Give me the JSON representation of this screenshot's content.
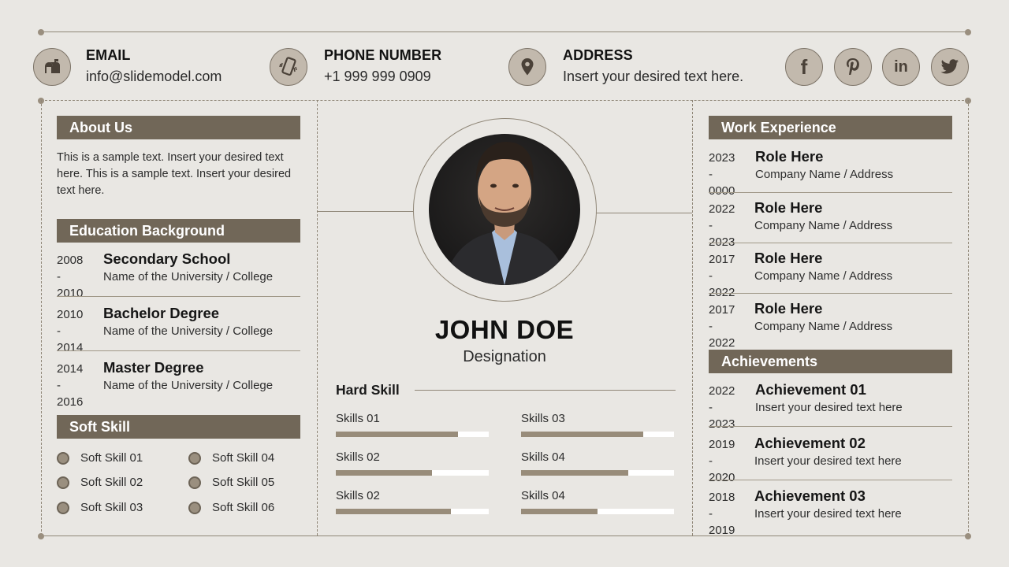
{
  "contact": {
    "email": {
      "label": "EMAIL",
      "value": "info@slidemodel.com",
      "icon": "mailbox-icon"
    },
    "phone": {
      "label": "PHONE NUMBER",
      "value": "+1 999 999 0909",
      "icon": "phone-icon"
    },
    "address": {
      "label": "ADDRESS",
      "value": "Insert your desired text here.",
      "icon": "map-pin-icon"
    }
  },
  "social": [
    {
      "name": "facebook",
      "glyph": "f",
      "icon": "facebook-icon"
    },
    {
      "name": "pinterest",
      "glyph": "P",
      "icon": "pinterest-icon"
    },
    {
      "name": "linkedin",
      "glyph": "in",
      "icon": "linkedin-icon"
    },
    {
      "name": "twitter",
      "glyph": "t",
      "icon": "twitter-icon"
    }
  ],
  "about": {
    "title": "About Us",
    "text": "This is a sample text. Insert your desired text here. This is a sample text. Insert your desired text here."
  },
  "education": {
    "title": "Education Background",
    "items": [
      {
        "years_from": "2008 -",
        "years_to": "2010",
        "degree": "Secondary School",
        "school": "Name of the University / College"
      },
      {
        "years_from": "2010 -",
        "years_to": "2014",
        "degree": "Bachelor Degree",
        "school": "Name of the University / College"
      },
      {
        "years_from": "2014 -",
        "years_to": "2016",
        "degree": "Master Degree",
        "school": "Name of the University / College"
      }
    ]
  },
  "soft_skill": {
    "title": "Soft Skill",
    "items": [
      "Soft Skill 01",
      "Soft Skill 02",
      "Soft Skill 03",
      "Soft Skill 04",
      "Soft Skill 05",
      "Soft Skill 06"
    ]
  },
  "profile": {
    "name": "JOHN DOE",
    "designation": "Designation"
  },
  "hard_skill": {
    "title": "Hard Skill",
    "items": [
      {
        "label": "Skills 01",
        "level": 0.8
      },
      {
        "label": "Skills 02",
        "level": 0.63
      },
      {
        "label": "Skills 02",
        "level": 0.75
      },
      {
        "label": "Skills 03",
        "level": 0.8
      },
      {
        "label": "Skills 04",
        "level": 0.7
      },
      {
        "label": "Skills 04",
        "level": 0.5
      }
    ]
  },
  "work": {
    "title": "Work Experience",
    "items": [
      {
        "years_from": "2023 -",
        "years_to": "0000",
        "role": "Role Here",
        "company": "Company Name / Address"
      },
      {
        "years_from": "2022 -",
        "years_to": "2023",
        "role": "Role Here",
        "company": "Company Name / Address"
      },
      {
        "years_from": "2017 -",
        "years_to": "2022",
        "role": "Role Here",
        "company": "Company Name / Address"
      },
      {
        "years_from": "2017 -",
        "years_to": "2022",
        "role": "Role Here",
        "company": "Company Name / Address"
      }
    ]
  },
  "achievements": {
    "title": "Achievements",
    "items": [
      {
        "years_from": "2022 -",
        "years_to": "2023",
        "title": "Achievement 01",
        "text": "Insert your desired text here"
      },
      {
        "years_from": "2019 -",
        "years_to": "2020",
        "title": "Achievement 02",
        "text": "Insert your desired text here"
      },
      {
        "years_from": "2018 -",
        "years_to": "2019",
        "title": "Achievement 03",
        "text": "Insert your desired text here"
      }
    ]
  },
  "colors": {
    "background": "#e9e7e3",
    "section_header": "#716758",
    "icon_fill": "#c2b9ad",
    "bar_fill": "#988c7a",
    "bar_track": "#ffffff"
  }
}
